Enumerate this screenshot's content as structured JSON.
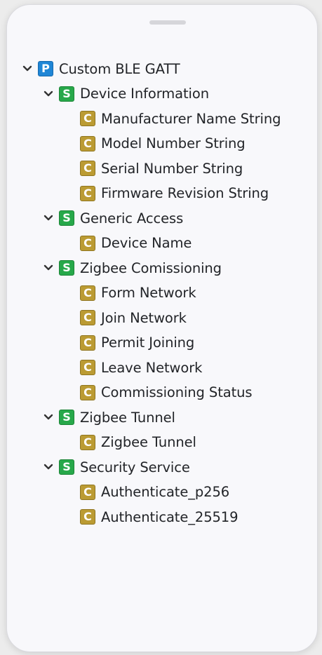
{
  "tree": {
    "root": {
      "badge": "P",
      "label": "Custom BLE GATT",
      "icon": "profile-icon",
      "color": "#1f86d6"
    },
    "services": [
      {
        "badge": "S",
        "label": "Device Information",
        "characteristics": [
          {
            "badge": "C",
            "label": "Manufacturer Name String"
          },
          {
            "badge": "C",
            "label": "Model Number String"
          },
          {
            "badge": "C",
            "label": "Serial Number String"
          },
          {
            "badge": "C",
            "label": "Firmware Revision String"
          }
        ]
      },
      {
        "badge": "S",
        "label": "Generic Access",
        "characteristics": [
          {
            "badge": "C",
            "label": "Device Name"
          }
        ]
      },
      {
        "badge": "S",
        "label": "Zigbee Comissioning",
        "characteristics": [
          {
            "badge": "C",
            "label": "Form Network"
          },
          {
            "badge": "C",
            "label": "Join Network"
          },
          {
            "badge": "C",
            "label": "Permit Joining"
          },
          {
            "badge": "C",
            "label": "Leave Network"
          },
          {
            "badge": "C",
            "label": "Commissioning Status"
          }
        ]
      },
      {
        "badge": "S",
        "label": "Zigbee Tunnel",
        "characteristics": [
          {
            "badge": "C",
            "label": "Zigbee Tunnel"
          }
        ]
      },
      {
        "badge": "S",
        "label": "Security Service",
        "characteristics": [
          {
            "badge": "C",
            "label": "Authenticate_p256"
          },
          {
            "badge": "C",
            "label": "Authenticate_25519"
          }
        ]
      }
    ]
  },
  "colors": {
    "profile": "#1f86d6",
    "service": "#27a84a",
    "characteristic": "#bb9b33"
  }
}
